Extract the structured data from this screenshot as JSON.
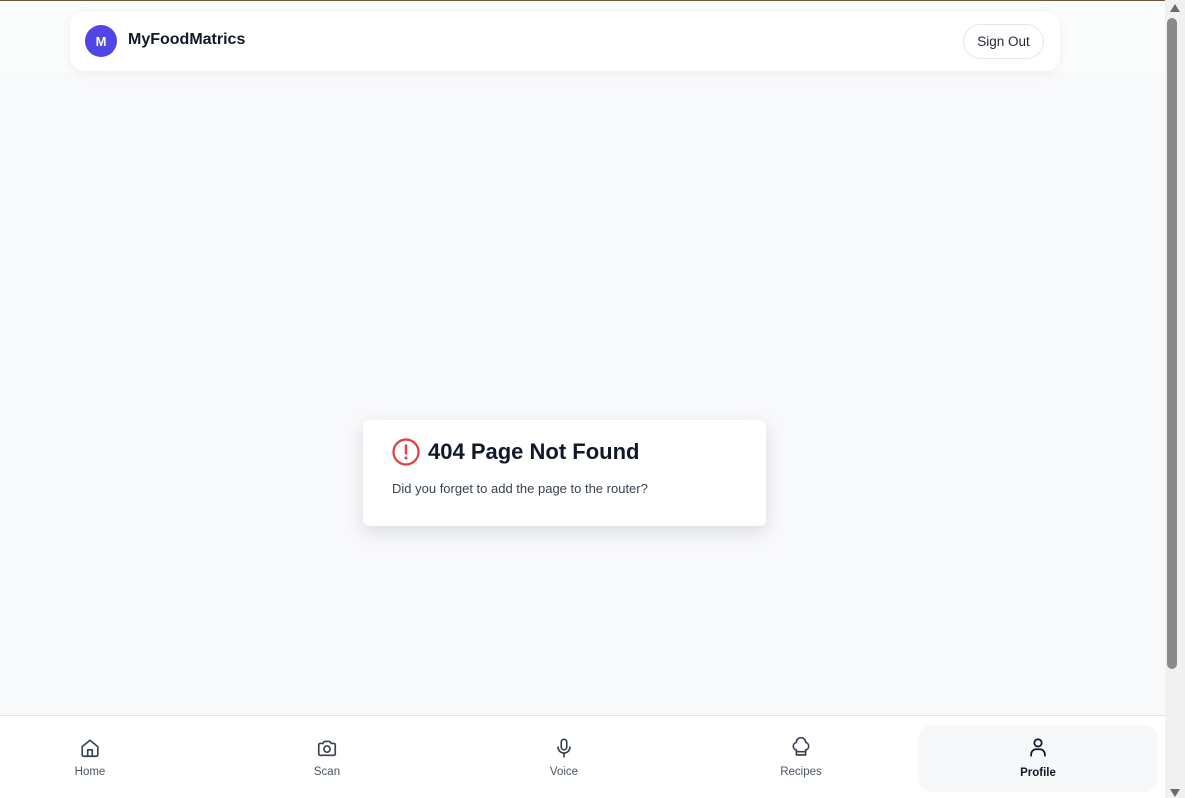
{
  "app": {
    "logo_letter": "M",
    "brand_name": "MyFoodMatrics",
    "accent_color": "#4f46e5"
  },
  "header": {
    "sign_out_label": "Sign Out"
  },
  "error": {
    "icon": "alert-circle-icon",
    "icon_color": "#e53e3e",
    "title": "404 Page Not Found",
    "message": "Did you forget to add the page to the router?"
  },
  "nav": {
    "items": [
      {
        "label": "Home",
        "icon": "home-icon",
        "active": false
      },
      {
        "label": "Scan",
        "icon": "camera-icon",
        "active": false
      },
      {
        "label": "Voice",
        "icon": "microphone-icon",
        "active": false
      },
      {
        "label": "Recipes",
        "icon": "chef-hat-icon",
        "active": false
      },
      {
        "label": "Profile",
        "icon": "user-icon",
        "active": true
      }
    ]
  }
}
